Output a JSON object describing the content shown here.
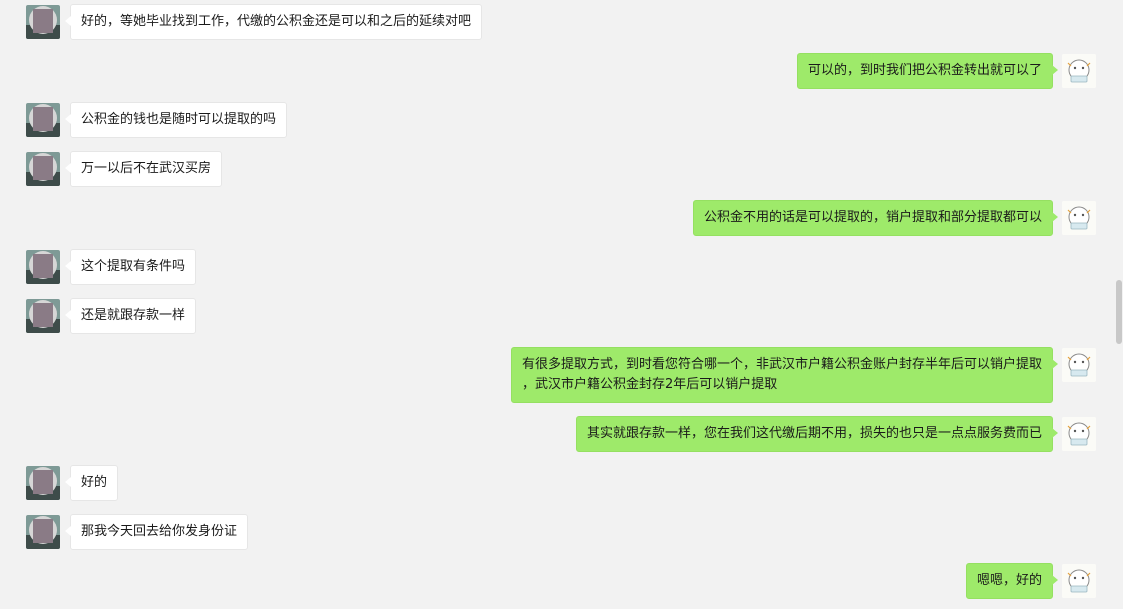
{
  "messages": [
    {
      "side": "left",
      "text": "好的，等她毕业找到工作，代缴的公积金还是可以和之后的延续对吧"
    },
    {
      "side": "right",
      "text": "可以的，到时我们把公积金转出就可以了"
    },
    {
      "side": "left",
      "text": "公积金的钱也是随时可以提取的吗"
    },
    {
      "side": "left",
      "text": "万一以后不在武汉买房"
    },
    {
      "side": "right",
      "text": "公积金不用的话是可以提取的，销户提取和部分提取都可以"
    },
    {
      "side": "left",
      "text": "这个提取有条件吗"
    },
    {
      "side": "left",
      "text": "还是就跟存款一样"
    },
    {
      "side": "right",
      "text": "有很多提取方式，到时看您符合哪一个，非武汉市户籍公积金账户封存半年后可以销户提取\n，武汉市户籍公积金封存2年后可以销户提取"
    },
    {
      "side": "right",
      "text": "其实就跟存款一样，您在我们这代缴后期不用，损失的也只是一点点服务费而已"
    },
    {
      "side": "left",
      "text": "好的"
    },
    {
      "side": "left",
      "text": "那我今天回去给你发身份证"
    },
    {
      "side": "right",
      "text": "嗯嗯，好的"
    }
  ],
  "colors": {
    "background": "#f2f2f2",
    "bubble_self": "#9eea6a",
    "bubble_other": "#ffffff",
    "text": "#1a1a1a"
  }
}
